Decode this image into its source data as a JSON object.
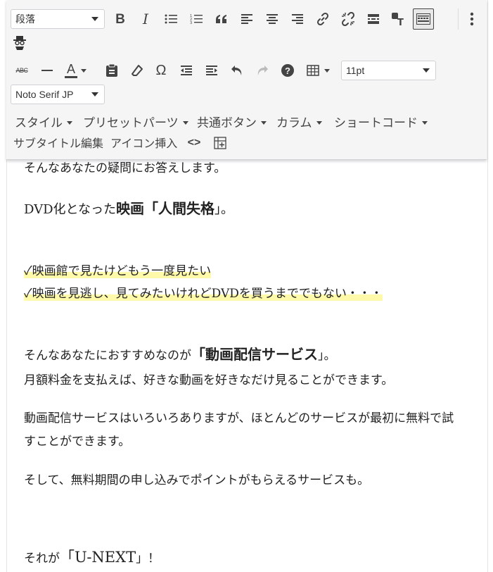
{
  "toolbar": {
    "format_select": "段落",
    "font_size_select": "11pt",
    "font_family_select": "Noto Serif JP",
    "strike_label": "ABC",
    "icons": [
      "bold-icon",
      "italic-icon",
      "bullet-list-icon",
      "numbered-list-icon",
      "blockquote-icon",
      "align-left-icon",
      "align-center-icon",
      "align-right-icon",
      "link-icon",
      "unlink-icon",
      "read-more-icon",
      "paste-text-icon",
      "toolbar-toggle-icon",
      "more-options-icon",
      "spy-icon",
      "strikethrough-icon",
      "horizontal-line-icon",
      "text-color-icon",
      "paste-icon",
      "clear-formatting-icon",
      "special-character-icon",
      "outdent-icon",
      "indent-icon",
      "undo-icon",
      "redo-icon",
      "help-icon",
      "table-icon"
    ],
    "bold_label": "B",
    "italic_label": "I",
    "text_color_label": "A",
    "omega_label": "Ω",
    "help_label": "?",
    "menus": [
      {
        "label": "スタイル"
      },
      {
        "label": "プリセットパーツ"
      },
      {
        "label": "共通ボタン"
      },
      {
        "label": "カラム"
      },
      {
        "label": "ショートコード"
      }
    ],
    "buttons": [
      {
        "label": "サブタイトル編集"
      },
      {
        "label": "アイコン挿入"
      }
    ],
    "code_label": "<>"
  },
  "content": {
    "line1": "そんなあなたの疑問にお答えします。",
    "line2_pre": "DVD化となった",
    "line2_bold": "映画「人間失格",
    "line2_post": "」。",
    "check1": "✓映画館で見たけどもう一度見たい",
    "check2": "✓映画を見逃し、見てみたいけれどDVDを買うまででもない・・・",
    "line3_pre": "そんなあなたにおすすめなのが",
    "line3_bold": "「動画配信サービス",
    "line3_post": "」。",
    "line4": "月額料金を支払えば、好きな動画を好きなだけ見ることができます。",
    "line5a": "動画配信サービスはいろいろありますが、ほとんどのサービスが最初に無料で試",
    "line5b": "すことができます。",
    "line6": "そして、無料期間の申し込みでポイントがもらえるサービスも。",
    "line7_pre": "それが",
    "line7_big": "「U-NEXT",
    "line7_post": "」！"
  },
  "colors": {
    "highlight": "#fffaaa",
    "toolbar_bg": "#f5f5f5"
  }
}
